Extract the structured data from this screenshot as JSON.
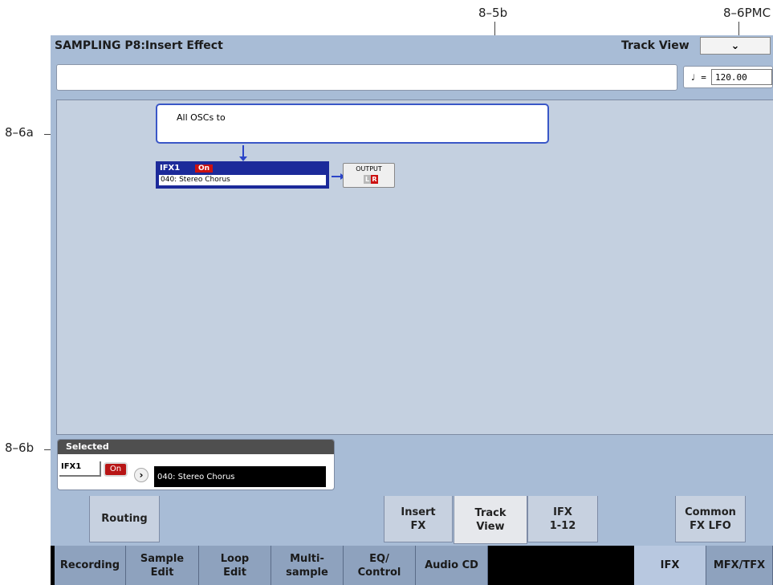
{
  "callouts": {
    "top_center": "8–5b",
    "top_right": "8–6PMC",
    "left_a": "8–6a",
    "left_b": "8–6b"
  },
  "header": {
    "title": "SAMPLING P8:Insert Effect",
    "view_label": "Track View",
    "view_button_icon": "chevron-down-icon",
    "view_button_glyph": "⌄"
  },
  "tempo": {
    "symbol": "♩ =",
    "value": "120.00"
  },
  "routing": {
    "source_label": "All OSCs to",
    "ifx_name": "IFX1",
    "ifx_status": "On",
    "ifx_effect": "040: Stereo Chorus",
    "output_label": "OUTPUT",
    "output_l": "L",
    "output_r": "R"
  },
  "selected": {
    "header": "Selected",
    "ifx": "IFX1",
    "status": "On",
    "arrow": "›",
    "effect": "040: Stereo Chorus"
  },
  "upper_tabs": [
    {
      "label": "Routing",
      "active": false
    },
    {
      "label": "Insert\nFX",
      "active": false
    },
    {
      "label": "Track\nView",
      "active": true
    },
    {
      "label": "IFX\n1-12",
      "active": false
    },
    {
      "label": "Common\nFX LFO",
      "active": false
    }
  ],
  "bottom_tabs": [
    {
      "label": "Recording"
    },
    {
      "label": "Sample\nEdit"
    },
    {
      "label": "Loop\nEdit"
    },
    {
      "label": "Multi-\nsample"
    },
    {
      "label": "EQ/\nControl"
    },
    {
      "label": "Audio CD"
    },
    {
      "label": "IFX"
    },
    {
      "label": "MFX/TFX"
    }
  ],
  "colors": {
    "screen_bg": "#a8bcd6",
    "canvas_bg": "#c4d0e0",
    "routing_blue": "#2b45c8",
    "ifx_block": "#1c2a9a",
    "on_red": "#cc1111"
  }
}
